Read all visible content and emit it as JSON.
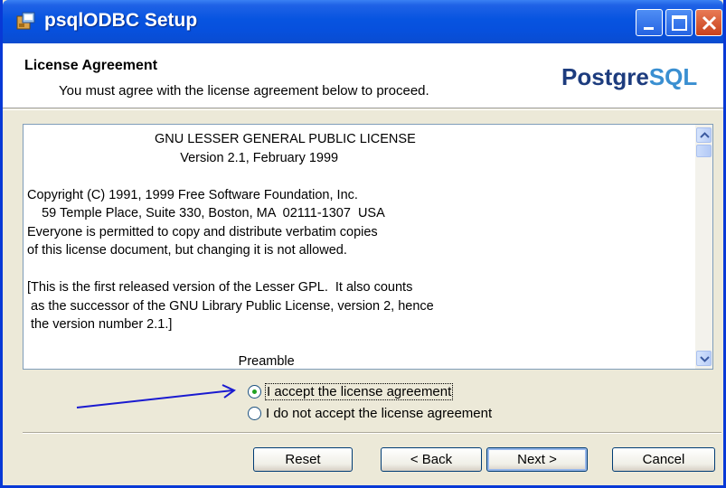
{
  "window": {
    "title": "psqlODBC Setup",
    "icons": [
      "setup-app-icon",
      "minimize-icon",
      "maximize-icon",
      "close-icon"
    ]
  },
  "header": {
    "title": "License Agreement",
    "subtitle": "You must agree with the license agreement below to proceed.",
    "logo_part1": "Postgre",
    "logo_part2": "SQL"
  },
  "license": {
    "text": "                                   GNU LESSER GENERAL PUBLIC LICENSE\n                                          Version 2.1, February 1999\n\nCopyright (C) 1991, 1999 Free Software Foundation, Inc.\n    59 Temple Place, Suite 330, Boston, MA  02111-1307  USA\nEveryone is permitted to copy and distribute verbatim copies\nof this license document, but changing it is not allowed.\n\n[This is the first released version of the Lesser GPL.  It also counts\n as the successor of the GNU Library Public License, version 2, hence\n the version number 2.1.]\n\n                                                          Preamble"
  },
  "options": {
    "accept_label": "I accept the license agreement",
    "decline_label": "I do not accept the license agreement",
    "selected": "accept"
  },
  "buttons": {
    "reset": "Reset",
    "back": "< Back",
    "next": "Next >",
    "cancel": "Cancel"
  },
  "colors": {
    "titlebar": "#0754e0",
    "logo_dark": "#1d3c7e",
    "logo_light": "#3a8fd1",
    "annotation_arrow": "#1a1ad0"
  }
}
